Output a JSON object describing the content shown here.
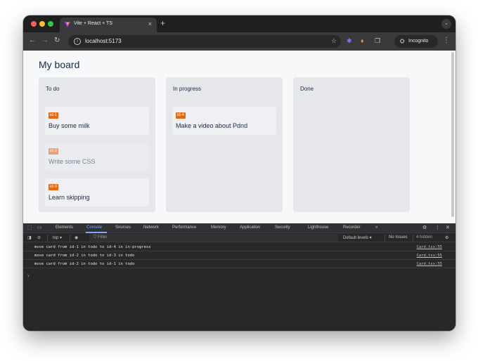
{
  "browser": {
    "tab_title": "Vite + React + TS",
    "tab_close": "×",
    "new_tab": "+",
    "tab_search": "⌄",
    "url": "localhost:5173",
    "incognito_label": "Incognito",
    "nav_back": "←",
    "nav_forward": "→",
    "nav_reload": "↻",
    "star": "☆",
    "menu": "⋮"
  },
  "board": {
    "title": "My board",
    "columns": [
      {
        "title": "To do",
        "cards": [
          {
            "id": "id-1",
            "text": "Buy some milk"
          },
          {
            "id": "id-2",
            "text": "Write some CSS"
          },
          {
            "id": "id-3",
            "text": "Learn skipping"
          }
        ]
      },
      {
        "title": "In progress",
        "cards": [
          {
            "id": "id-4",
            "text": "Make a video about Pdnd"
          }
        ]
      },
      {
        "title": "Done",
        "cards": []
      }
    ]
  },
  "devtools": {
    "tabs": [
      "Elements",
      "Console",
      "Sources",
      "Network",
      "Performance",
      "Memory",
      "Application",
      "Security",
      "Lighthouse",
      "Recorder",
      "»"
    ],
    "context": "top ▾",
    "filter_placeholder": "Filter",
    "levels": "Default levels ▾",
    "issues": "No Issues",
    "hidden": "4 hidden",
    "logs": [
      {
        "message": "move card from id-1 in todo to id-4 in in-progress",
        "source": "Card.tsx:55"
      },
      {
        "message": "move card from id-2 in todo to id-3 in todo",
        "source": "Card.tsx:55"
      },
      {
        "message": "move card from id-2 in todo to id-1 in todo",
        "source": "Card.tsx:55"
      }
    ],
    "prompt": "›"
  },
  "colors": {
    "badge": "#e56910",
    "active_tab": "#7cacf8"
  }
}
